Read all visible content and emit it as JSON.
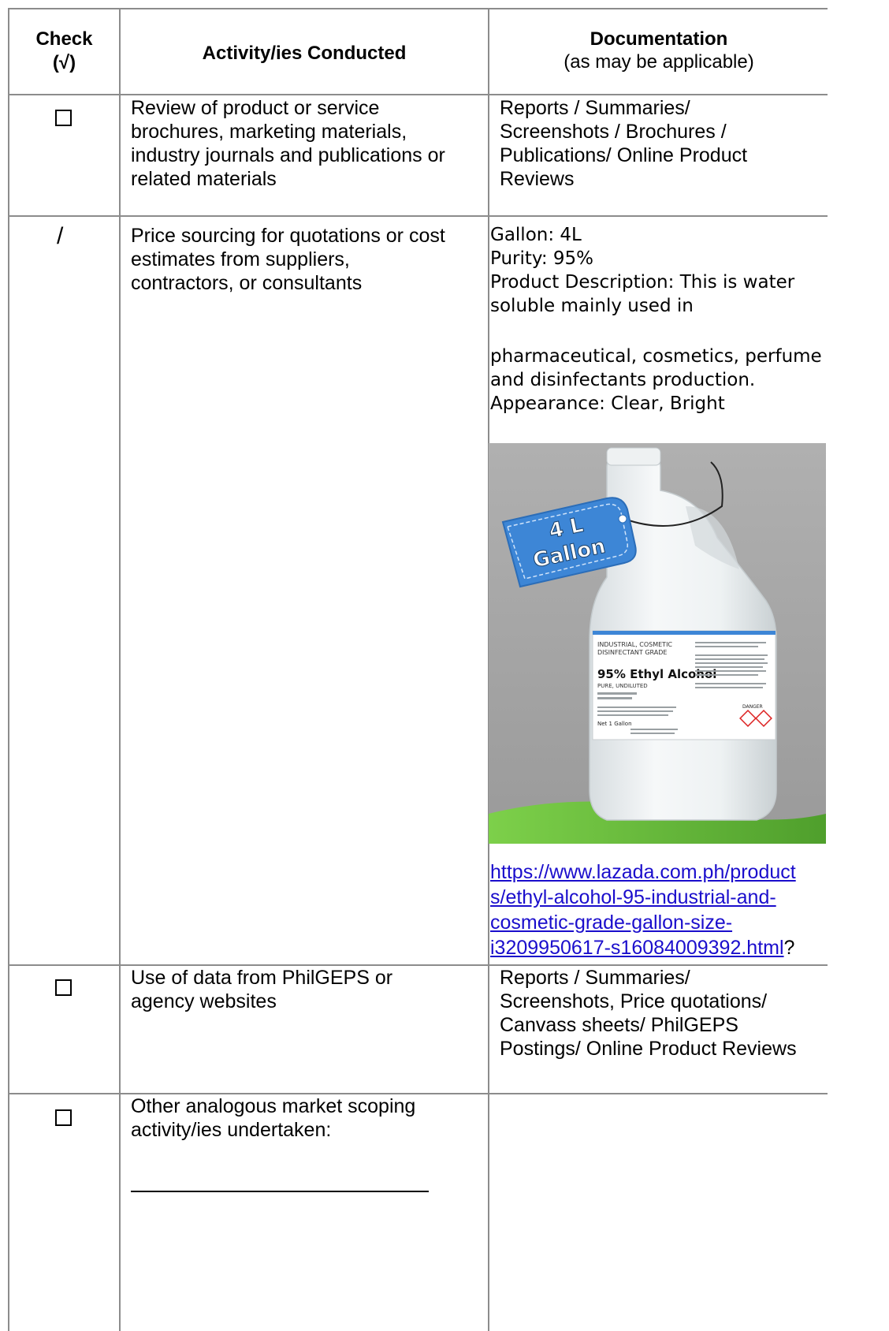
{
  "header": {
    "check_label": "Check",
    "check_symbol": "(√)",
    "activity_label": "Activity/ies Conducted",
    "documentation_label": "Documentation",
    "documentation_note": "(as may be applicable)"
  },
  "rows": [
    {
      "checked": false,
      "activity_lines": [
        "Review of product or service",
        "brochures, marketing materials,",
        "industry journals and publications or",
        "related materials"
      ],
      "doc_lines": [
        "Reports / Summaries/",
        "Screenshots / Brochures /",
        "Publications/ Online Product",
        "Reviews"
      ]
    },
    {
      "checked": true,
      "check_text": "/",
      "activity_lines": [
        "Price sourcing for quotations or cost",
        "estimates from suppliers,",
        "contractors, or consultants"
      ],
      "doc_lines": [
        "Gallon: 4L",
        "Purity: 95%",
        "Product Description: This is water",
        "soluble mainly used in",
        "",
        "pharmaceutical, cosmetics, perfume",
        "and disinfectants production.",
        "Appearance: Clear, Bright"
      ],
      "link_lines": [
        "https://www.lazada.com.ph/product",
        "s/ethyl-alcohol-95-industrial-and-",
        "cosmetic-grade-gallon-size-",
        "i3209950617-s16084009392.html"
      ],
      "link_suffix": "?"
    },
    {
      "checked": false,
      "activity_lines": [
        "Use of data from PhilGEPS or",
        "agency websites"
      ],
      "doc_lines": [
        "Reports / Summaries/",
        "Screenshots, Price quotations/",
        "Canvass sheets/ PhilGEPS",
        "Postings/ Online Product Reviews"
      ]
    },
    {
      "checked": false,
      "activity_lines": [
        "Other analogous market scoping",
        "activity/ies undertaken:"
      ],
      "doc_lines": []
    }
  ],
  "product_image": {
    "tag_line1": "4 L",
    "tag_line2": "Gallon",
    "label_grade_line1": "INDUSTRIAL, COSMETIC",
    "label_grade_line2": "DISINFECTANT GRADE",
    "label_title": "95% Ethyl Alcohol",
    "label_sub": "PURE, UNDILUTED",
    "label_net": "Net 1 Gallon",
    "label_danger": "DANGER",
    "colors": {
      "tag": "#3d86d6",
      "background": "#a6a6a6",
      "grass": "#6cbf3a"
    }
  }
}
